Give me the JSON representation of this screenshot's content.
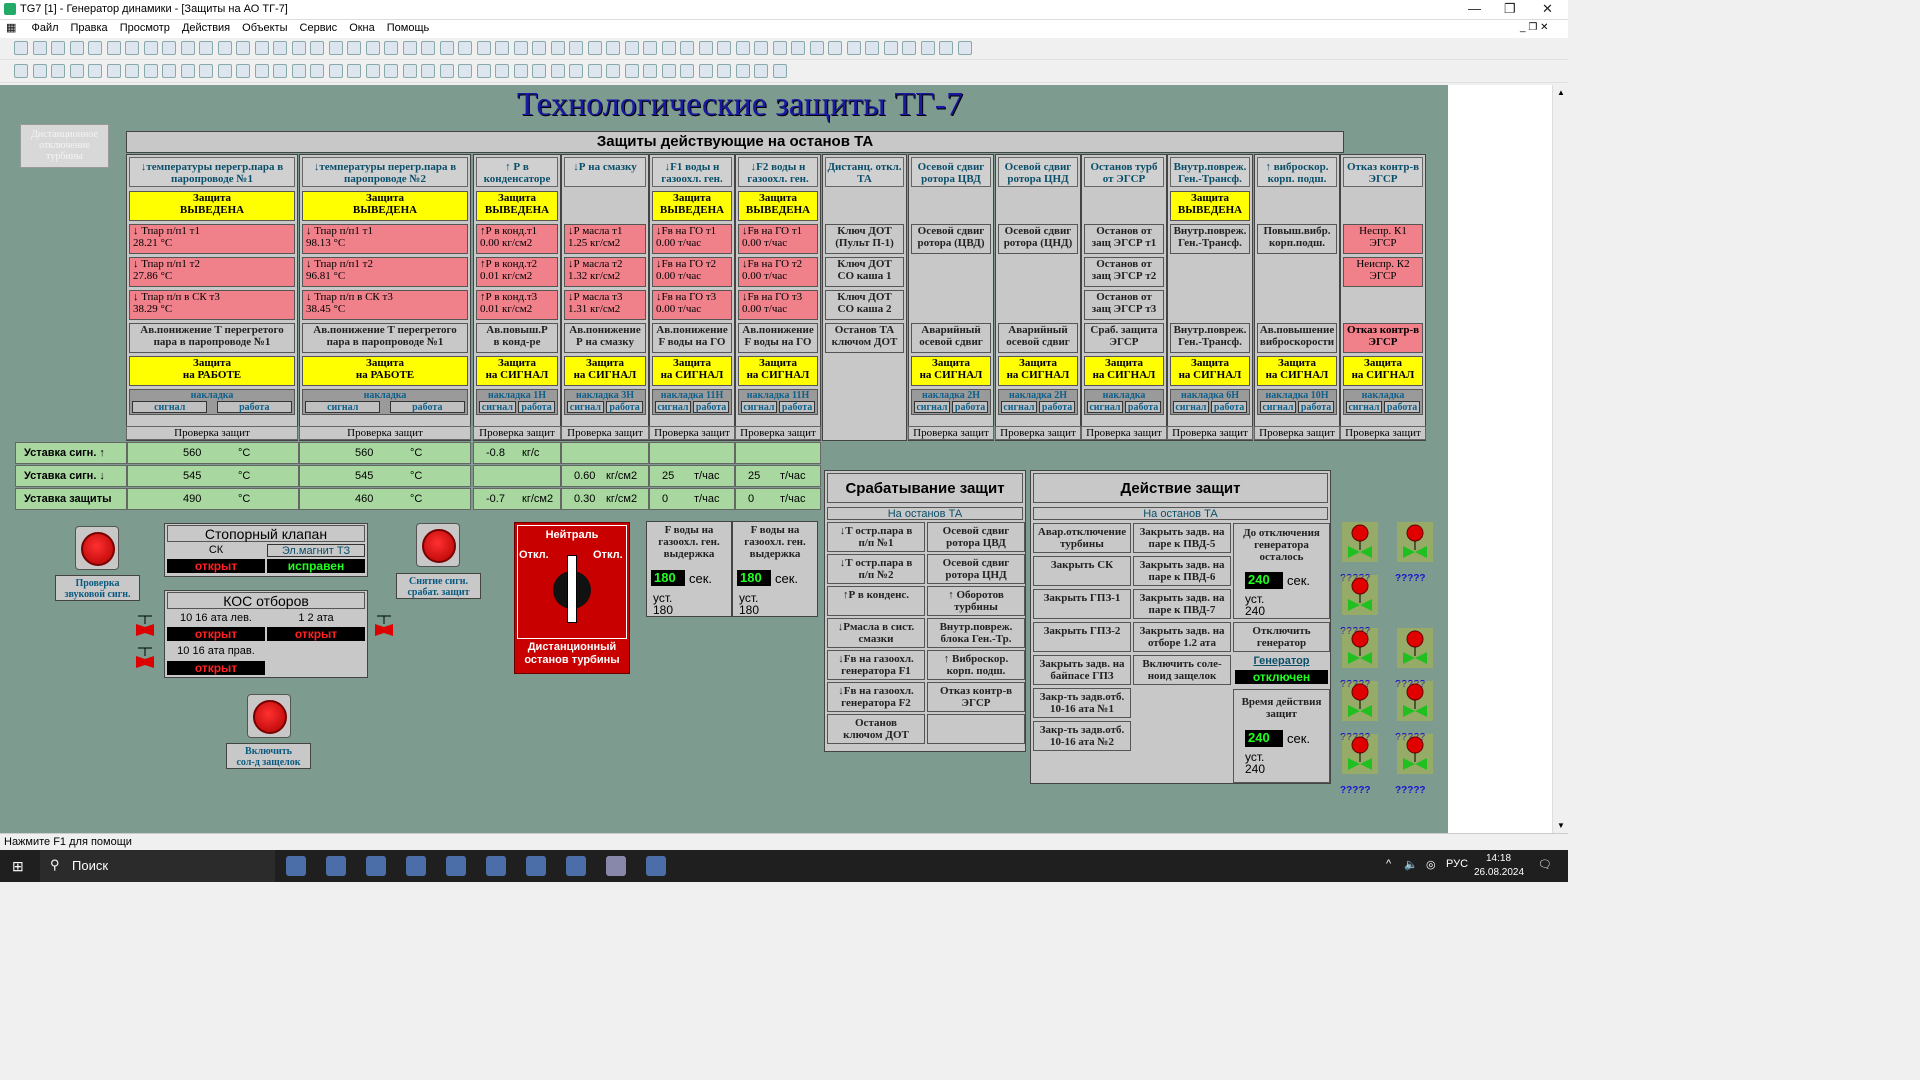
{
  "window": {
    "title": "TG7 [1] - Генератор динамики - [Защиты на АО ТГ-7]"
  },
  "menu": [
    "Файл",
    "Правка",
    "Просмотр",
    "Действия",
    "Объекты",
    "Сервис",
    "Окна",
    "Помощь"
  ],
  "main_title": "Технологические защиты ТГ-7",
  "dist_btn": "Дистанционное\nотключение\nтурбины",
  "section_title": "Защиты действующие на останов ТА",
  "columns": [
    {
      "h": "↓температуры перегр.пара\nв паропроводе №1",
      "prot": "Защита\nВЫВЕДЕНА",
      "rows": [
        "↓         Тпар п/п1 т1\n28.21     °С",
        "↓         Тпар п/п1 т2\n27.86     °С",
        "↓   Тпар п/п в СК т3\n38.29     °С"
      ],
      "av": "Ав.понижение Т перегретого\nпара в паропроводе №1",
      "z2": "Защита\nна РАБОТЕ",
      "nak": "накладка",
      "sig": "сигнал",
      "rab": "работа",
      "prov": "Проверка защит"
    },
    {
      "h": "↓температуры перегр.пара\nв паропроводе №2",
      "prot": "Защита\nВЫВЕДЕНА",
      "rows": [
        "↓         Тпар п/п1 т1\n98.13     °С",
        "↓         Тпар п/п1 т2\n96.81     °С",
        "↓   Тпар п/п в СК т3\n38.45     °С"
      ],
      "av": "Ав.понижение Т перегретого\nпара в паропроводе №1",
      "z2": "Защита\nна РАБОТЕ",
      "nak": "накладка",
      "sig": "сигнал",
      "rab": "работа",
      "prov": "Проверка защит"
    },
    {
      "h": "↑ Р в\nконденсаторе",
      "prot": "Защита\nВЫВЕДЕНА",
      "rows": [
        "↑Р в конд.т1\n0.00  кг/см2",
        "↑Р в конд.т2\n0.01  кг/см2",
        "↑Р в конд.т3\n0.01  кг/см2"
      ],
      "av": "Ав.повыш.Р\nв конд-ре",
      "z2": "Защита\nна СИГНАЛ",
      "nak": "накладка 1Н",
      "sig": "сигнал",
      "rab": "работа",
      "prov": "Проверка защит"
    },
    {
      "h": "↓Р на смазку",
      "prot": "",
      "rows": [
        "↓Р масла т1\n1.25  кг/см2",
        "↓Р масла т2\n1.32  кг/см2",
        "↓Р масла т3\n1.31  кг/см2"
      ],
      "av": "Ав.понижение\nР на смазку",
      "z2": "Защита\nна СИГНАЛ",
      "nak": "накладка 3Н",
      "sig": "сигнал",
      "rab": "работа",
      "prov": "Проверка защит"
    },
    {
      "h": "↓F1 воды н\nгазоохл. ген.",
      "prot": "Защита\nВЫВЕДЕНА",
      "rows": [
        "↓Fв на ГО т1\n0.00  т/час",
        "↓Fв на ГО т2\n0.00  т/час",
        "↓Fв на ГО т3\n0.00  т/час"
      ],
      "av": "Ав.понижение\nF воды на ГО",
      "z2": "Защита\nна СИГНАЛ",
      "nak": "накладка 11Н",
      "sig": "сигнал",
      "rab": "работа",
      "prov": "Проверка защит"
    },
    {
      "h": "↓F2 воды н\nгазоохл. ген.",
      "prot": "Защита\nВЫВЕДЕНА",
      "rows": [
        "↓Fв на ГО т1\n0.00  т/час",
        "↓Fв на ГО т2\n0.00  т/час",
        "↓Fв на ГО т3\n0.00  т/час"
      ],
      "av": "Ав.понижение\nF воды на ГО",
      "z2": "Защита\nна СИГНАЛ",
      "nak": "накладка 11Н",
      "sig": "сигнал",
      "rab": "работа",
      "prov": "Проверка защит"
    }
  ],
  "dist_col": {
    "h": "Дистанц.\nоткл. ТА",
    "rows": [
      "Ключ ДОТ\n(Пульт П-1)",
      "Ключ ДОТ\nСО каша 1",
      "Ключ ДОТ\nСО каша 2"
    ],
    "av": "Останов ТА\nключом ДОТ"
  },
  "right_cols": [
    {
      "h": "Осевой сдвиг\nротора ЦВД",
      "prot": "",
      "rows": [
        "Осевой сдвиг\nротора (ЦВД)"
      ],
      "av": "Аварийный\nосевой сдвиг",
      "z2": "Защита\nна СИГНАЛ",
      "nak": "накладка 2Н",
      "sig": "сигнал",
      "rab": "работа",
      "prov": "Проверка защит"
    },
    {
      "h": "Осевой сдвиг\nротора ЦНД",
      "prot": "",
      "rows": [
        "Осевой сдвиг\nротора (ЦНД)"
      ],
      "av": "Аварийный\nосевой сдвиг",
      "z2": "Защита\nна СИГНАЛ",
      "nak": "накладка 2Н",
      "sig": "сигнал",
      "rab": "работа",
      "prov": "Проверка защит"
    },
    {
      "h": "Останов турб\nот ЭГСР",
      "prot": "",
      "rows": [
        "Останов от\nзащ ЭГСР т1",
        "Останов от\nзащ ЭГСР т2",
        "Останов от\nзащ ЭГСР т3"
      ],
      "av": "Сраб. защита\nЭГСР",
      "z2": "Защита\nна СИГНАЛ",
      "nak": "накладка",
      "sig": "сигнал",
      "rab": "работа",
      "prov": "Проверка защит"
    },
    {
      "h": "Внутр.повреж.\nГен.-Трансф.",
      "prot": "Защита\nВЫВЕДЕНА",
      "rows": [
        "Внутр.повреж.\nГен.-Трансф."
      ],
      "av": "Внутр.повреж.\nГен.-Трансф.",
      "z2": "Защита\nна СИГНАЛ",
      "nak": "накладка 6Н",
      "sig": "сигнал",
      "rab": "работа",
      "prov": "Проверка защит"
    },
    {
      "h": "↑ виброскор.\nкорп. подш.",
      "prot": "",
      "rows": [
        "Повыш.вибр.\nкорп.подш."
      ],
      "av": "Ав.повышение\nвиброскорости",
      "z2": "Защита\nна СИГНАЛ",
      "nak": "накладка 10Н",
      "sig": "сигнал",
      "rab": "работа",
      "prov": "Проверка защит"
    },
    {
      "h": "Отказ контр-в\nЭГСР",
      "prot": "",
      "rows": [
        "Неспр. К1\nЭГСР",
        "Неиспр. К2\nЭГСР"
      ],
      "av": "Отказ контр-в\nЭГСР",
      "z2": "Защита\nна СИГНАЛ",
      "nak": "накладка",
      "sig": "сигнал",
      "rab": "работа",
      "prov": "Проверка защит"
    }
  ],
  "setpoints": {
    "labels": [
      "Уставка сигн. ↑",
      "Уставка сигн. ↓",
      "Уставка защиты"
    ],
    "c1": [
      "560",
      "545",
      "490"
    ],
    "c2": [
      "560",
      "545",
      "460"
    ],
    "unit": "°С",
    "c3": [
      "-0.8",
      "",
      "-0.7"
    ],
    "c3u": [
      "кг/с",
      "",
      "кг/см2"
    ],
    "c4": [
      "",
      "0.60",
      "0.30"
    ],
    "c4u": [
      "",
      "кг/см2",
      "кг/см2"
    ],
    "c5": [
      "",
      "25",
      "0"
    ],
    "c5u": [
      "",
      "т/час",
      "т/час"
    ],
    "c6": [
      "",
      "25",
      "0"
    ],
    "c6u": [
      "",
      "т/час",
      "т/час"
    ]
  },
  "btn_sound": "Проверка\nзвуковой сигн.",
  "btn_reset": "Снятие сигн.\nсрабат. защит",
  "btn_solenoid": "Включить\nсол-д защелок",
  "stop_valve": {
    "title": "Стопорный клапан",
    "sk": "СК",
    "sk_state": "открыт",
    "em": "Эл.магнит ТЗ",
    "em_state": "исправен"
  },
  "kos": {
    "title": "КОС отборов",
    "a": "10 16 ата лев.",
    "a_state": "открыт",
    "b": "1 2 ата",
    "b_state": "открыт",
    "c": "10 16 ата прав.",
    "c_state": "открыт"
  },
  "dist_stop": {
    "neutral": "Нейтраль",
    "off_l": "Откл.",
    "off_r": "Откл.",
    "label": "Дистанционный\nостанов турбины"
  },
  "fwater": [
    {
      "t": "F воды на\nгазоохл. ген.\nвыдержка",
      "v": "180",
      "u": "сек.",
      "ust": "уст.\n180"
    },
    {
      "t": "F воды на\nгазоохл. ген.\nвыдержка",
      "v": "180",
      "u": "сек.",
      "ust": "уст.\n180"
    }
  ],
  "trip": {
    "title": "Срабатывание защит",
    "sub": "На останов ТА",
    "cells": [
      "↓Т остр.пара в\nп/п №1",
      "Осевой сдвиг\nротора ЦВД",
      "↓Т остр.пара в\nп/п №2",
      "Осевой сдвиг\nротора ЦНД",
      "↑Р в конденс.",
      "↑  Оборотов\nтурбины",
      "↓Рмасла в сист.\nсмазки",
      "Внутр.повреж.\nблока Ген.-Тр.",
      "↓Fв на газоохл.\nгенератора F1",
      "↑  Виброскор.\nкорп. подш.",
      "↓Fв на газоохл.\nгенератора F2",
      "Отказ контр-в\nЭГСР",
      "Останов\nключом ДОТ",
      ""
    ]
  },
  "action": {
    "title": "Действие защит",
    "sub": "На останов ТА",
    "c1": [
      "Авар.отключение\nтурбины",
      "Закрыть СК",
      "Закрыть ГПЗ-1",
      "Закрыть ГПЗ-2",
      "Закрыть задв. на\nбайпасе ГПЗ",
      "Закр-ть задв.отб.\n10-16 ата №1",
      "Закр-ть задв.отб.\n10-16 ата №2"
    ],
    "c2": [
      "Закрыть задв. на\nпаре к ПВД-5",
      "Закрыть задв. на\nпаре к ПВД-6",
      "Закрыть задв. на\nпаре к ПВД-7",
      "Закрыть задв. на\nотборе 1.2 ата",
      "Включить соле-\nноид защелок"
    ],
    "gen_off_t": "До отключения\nгенератора\nосталось",
    "gen_off_v": "240",
    "gen_off_u": "сек.",
    "gen_off_ust": "уст.\n240",
    "off_gen": "Отключить\nгенератор",
    "gen_label": "Генератор",
    "gen_state": "отключен",
    "time_t": "Время действия\nзащит",
    "time_v": "240",
    "time_u": "сек.",
    "time_ust": "уст.\n240"
  },
  "alarm_q": "?????",
  "status": "Нажмите  F1 для помощи",
  "taskbar": {
    "search": "Поиск",
    "lang": "РУС",
    "time": "14:18",
    "date": "26.08.2024"
  }
}
